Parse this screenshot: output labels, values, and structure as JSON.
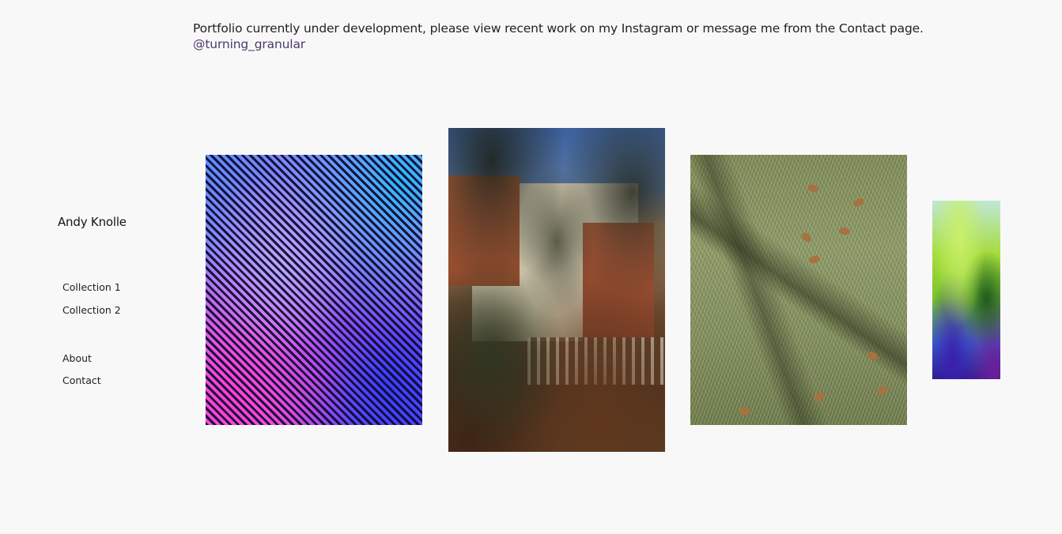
{
  "notice": {
    "text": "Portfolio currently under development, please view recent work on my Instagram or message me from the Contact page.",
    "instagram_handle": "@turning_granular"
  },
  "site": {
    "title": "Andy Knolle"
  },
  "nav": {
    "collections": [
      {
        "label": "Collection 1"
      },
      {
        "label": "Collection 2"
      }
    ],
    "pages": [
      {
        "label": "About"
      },
      {
        "label": "Contact"
      }
    ]
  },
  "colors": {
    "background": "#f8f8f8",
    "text": "#1e1e1e",
    "link": "#4c3a6e"
  },
  "gallery": {
    "photos": [
      {
        "subject": "holographic diagonal stripes"
      },
      {
        "subject": "house behind trees and fence"
      },
      {
        "subject": "grass with tree shadow and fallen leaves"
      },
      {
        "subject": "green and blue leaves, partially visible"
      }
    ]
  }
}
